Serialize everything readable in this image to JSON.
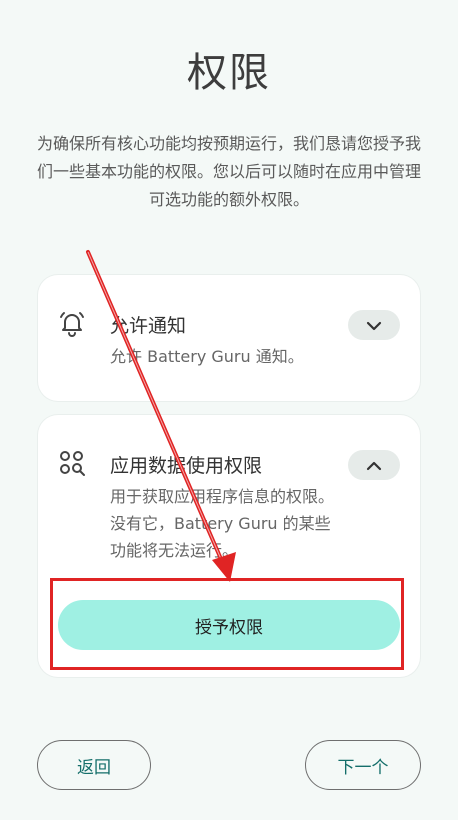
{
  "page": {
    "title": "权限",
    "description": "为确保所有核心功能均按预期运行，我们恳请您授予我们一些基本功能的权限。您以后可以随时在应用中管理可选功能的额外权限。"
  },
  "permissions": [
    {
      "title": "允许通知",
      "subtitle": "允许 Battery Guru 通知。",
      "icon": "bell-icon",
      "expanded": false
    },
    {
      "title": "应用数据使用权限",
      "subtitle": "用于获取应用程序信息的权限。没有它，Battery Guru 的某些功能将无法运行。",
      "icon": "usage-data-icon",
      "expanded": true,
      "action_label": "授予权限"
    }
  ],
  "footer": {
    "back_label": "返回",
    "next_label": "下一个"
  },
  "colors": {
    "background": "#f4f9f7",
    "accent_button": "#9ff0e3",
    "accent_text": "#146e6a",
    "annotation": "#e02424"
  }
}
